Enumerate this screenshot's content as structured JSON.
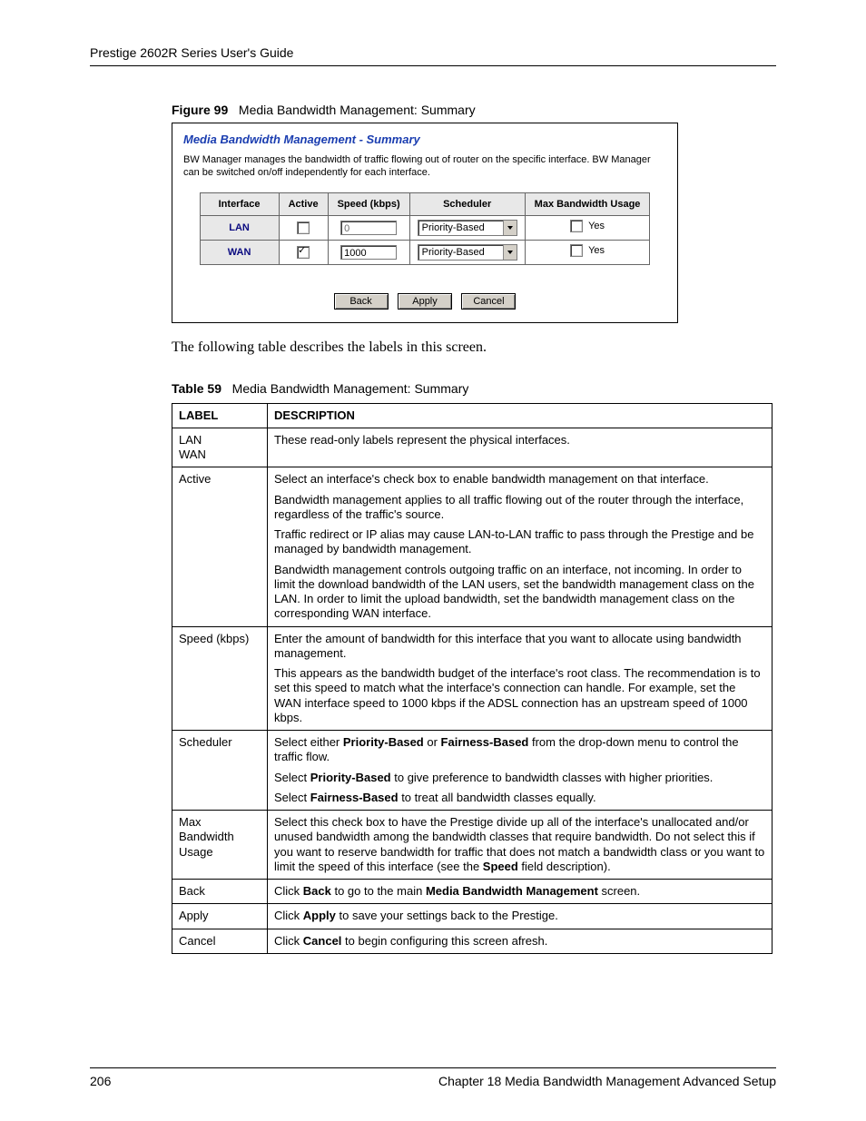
{
  "header": {
    "title": "Prestige 2602R Series User's Guide"
  },
  "figure": {
    "label": "Figure 99",
    "caption": "Media Bandwidth Management: Summary"
  },
  "screenshot": {
    "title": "Media Bandwidth Management - Summary",
    "intro": "BW Manager manages the bandwidth of traffic flowing out of router on the specific interface. BW Manager can be switched on/off independently for each interface.",
    "columns": {
      "iface": "Interface",
      "active": "Active",
      "speed": "Speed (kbps)",
      "scheduler": "Scheduler",
      "max": "Max Bandwidth Usage"
    },
    "rows": [
      {
        "iface": "LAN",
        "active": false,
        "speed": "0",
        "scheduler": "Priority-Based",
        "max_label": "Yes"
      },
      {
        "iface": "WAN",
        "active": true,
        "speed": "1000",
        "scheduler": "Priority-Based",
        "max_label": "Yes"
      }
    ],
    "buttons": {
      "back": "Back",
      "apply": "Apply",
      "cancel": "Cancel"
    }
  },
  "body_paragraph": "The following table describes the labels in this screen.",
  "table": {
    "label": "Table 59",
    "caption": "Media Bandwidth Management: Summary",
    "head": {
      "label": "LABEL",
      "desc": "DESCRIPTION"
    },
    "rows": {
      "r0": {
        "label_line1": "LAN",
        "label_line2": "WAN",
        "p1": "These read-only labels represent the physical interfaces."
      },
      "r1": {
        "label": "Active",
        "p1": "Select an interface's check box to enable bandwidth management on that interface.",
        "p2": "Bandwidth management applies to all traffic flowing out of the router through the interface, regardless of the traffic's source.",
        "p3": "Traffic redirect or IP alias may cause LAN-to-LAN traffic to pass through the Prestige and be managed by bandwidth management.",
        "p4": "Bandwidth management controls outgoing traffic on an interface, not incoming. In order to limit the download bandwidth of the LAN users, set the bandwidth management class on the LAN. In order to limit the upload bandwidth, set the bandwidth management class on the corresponding WAN interface."
      },
      "r2": {
        "label": "Speed (kbps)",
        "p1": "Enter the amount of bandwidth for this interface that you want to allocate using bandwidth management.",
        "p2": "This appears as the bandwidth budget of the interface's root class. The recommendation is to set this speed to match what the interface's connection can handle. For example, set the WAN interface speed to 1000 kbps if the ADSL connection has an upstream speed of 1000 kbps."
      },
      "r3": {
        "label": "Scheduler",
        "p1_pre": "Select either ",
        "p1_b1": "Priority-Based",
        "p1_mid": " or ",
        "p1_b2": "Fairness-Based",
        "p1_post": " from the drop-down menu to control the traffic flow.",
        "p2_pre": "Select ",
        "p2_b": "Priority-Based",
        "p2_post": " to give preference to bandwidth classes with higher priorities.",
        "p3_pre": "Select ",
        "p3_b": "Fairness-Based",
        "p3_post": " to treat all bandwidth classes equally."
      },
      "r4": {
        "label_line1": "Max",
        "label_line2": "Bandwidth",
        "label_line3": "Usage",
        "p1_pre": "Select this check box to have the Prestige divide up all of the interface's unallocated and/or unused bandwidth among the bandwidth classes that require bandwidth. Do not select this if you want to reserve bandwidth for traffic that does not match a bandwidth class or you want to limit the speed of this interface (see the ",
        "p1_b": "Speed",
        "p1_post": " field description)."
      },
      "r5": {
        "label": "Back",
        "p1_pre": "Click ",
        "p1_b1": "Back",
        "p1_mid": " to go to the main ",
        "p1_b2": "Media Bandwidth Management",
        "p1_post": " screen."
      },
      "r6": {
        "label": "Apply",
        "p1_pre": "Click ",
        "p1_b": "Apply",
        "p1_post": " to save your settings back to the Prestige."
      },
      "r7": {
        "label": "Cancel",
        "p1_pre": "Click ",
        "p1_b": "Cancel",
        "p1_post": " to begin configuring this screen afresh."
      }
    }
  },
  "footer": {
    "page": "206",
    "chapter": "Chapter 18 Media Bandwidth Management Advanced Setup"
  }
}
